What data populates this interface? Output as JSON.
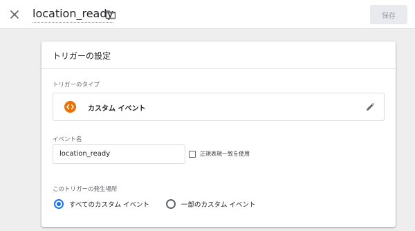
{
  "header": {
    "title": "location_ready",
    "save_label": "保存"
  },
  "card": {
    "title": "トリガーの設定",
    "trigger_type": {
      "section_label": "トリガーのタイプ",
      "name": "カスタム イベント",
      "icon": "custom-event-icon",
      "icon_color": "#e8710a"
    },
    "event_name": {
      "section_label": "イベント名",
      "value": "location_ready",
      "use_regex_label": "正規表現一致を使用",
      "use_regex_checked": false
    },
    "fire_on": {
      "section_label": "このトリガーの発生場所",
      "options": [
        {
          "label": "すべてのカスタム イベント",
          "selected": true
        },
        {
          "label": "一部のカスタム イベント",
          "selected": false
        }
      ]
    }
  },
  "colors": {
    "accent": "#1a73e8",
    "background": "#eeeeee"
  }
}
